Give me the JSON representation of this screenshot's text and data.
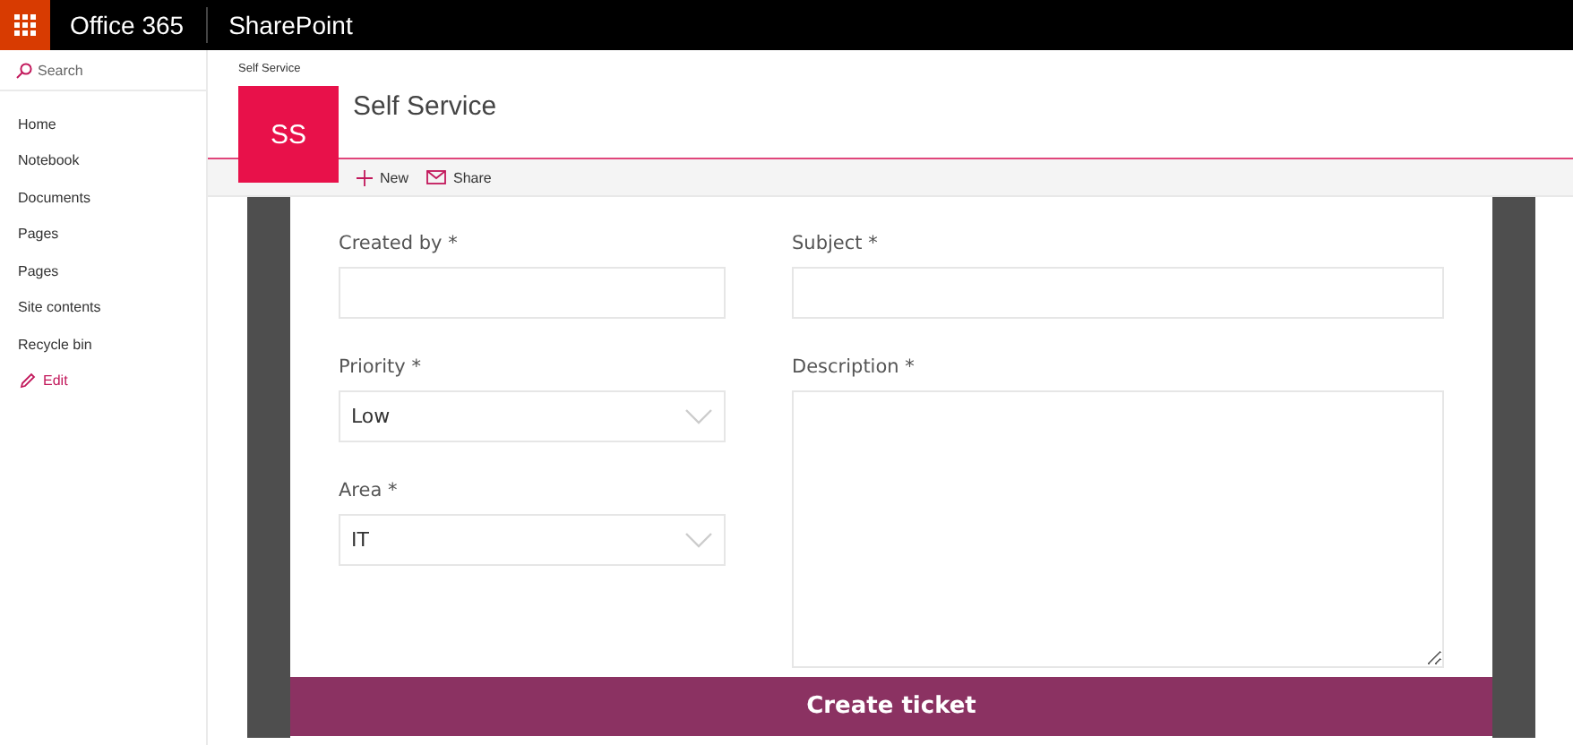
{
  "top_bar": {
    "brand": "Office 365",
    "app": "SharePoint"
  },
  "sidebar": {
    "search": {
      "placeholder": "Search"
    },
    "items": [
      {
        "label": "Home",
        "kind": "link"
      },
      {
        "label": "Notebook",
        "kind": "link"
      },
      {
        "label": "Documents",
        "kind": "link"
      },
      {
        "label": "Pages",
        "kind": "link"
      },
      {
        "label": "Pages",
        "kind": "link"
      },
      {
        "label": "Site contents",
        "kind": "link"
      },
      {
        "label": "Recycle bin",
        "kind": "link"
      },
      {
        "label": "Edit",
        "kind": "edit"
      }
    ]
  },
  "site": {
    "breadcrumb": "Self Service",
    "logo": "SS",
    "title": "Self Service"
  },
  "toolbar": [
    {
      "label": "New",
      "kind": "new"
    },
    {
      "label": "Share",
      "kind": "share"
    }
  ],
  "form": {
    "columns": [
      [
        {
          "label": "Created by *",
          "kind": "text"
        },
        {
          "label": "Priority *",
          "kind": "select",
          "value": "Low"
        },
        {
          "label": "Area *",
          "kind": "select",
          "value": "IT"
        }
      ],
      [
        {
          "label": "Subject *",
          "kind": "text"
        },
        {
          "label": "Description *",
          "kind": "textarea"
        }
      ]
    ],
    "submit": "Create ticket"
  }
}
